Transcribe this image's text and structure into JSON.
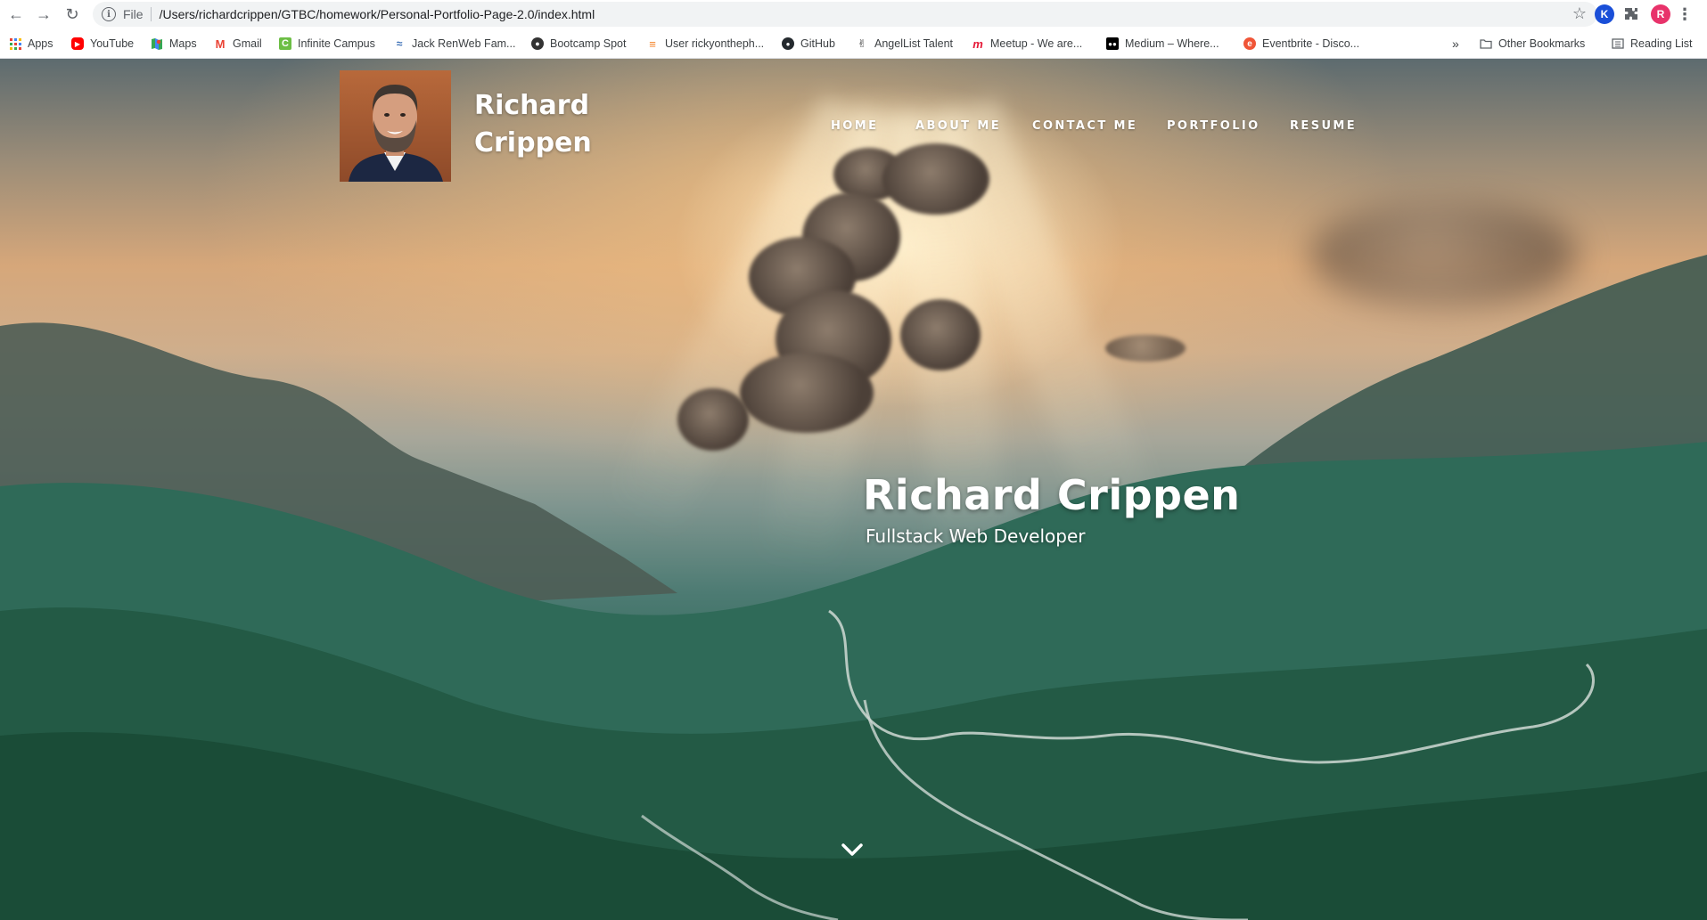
{
  "browser": {
    "url_scheme": "File",
    "url": "/Users/richardcrippen/GTBC/homework/Personal-Portfolio-Page-2.0/index.html",
    "profile_initial": "R",
    "extension_initial": "K"
  },
  "bookmarks": {
    "items": [
      {
        "label": "Apps",
        "icon": "apps-grid-icon"
      },
      {
        "label": "YouTube",
        "icon": "youtube-icon"
      },
      {
        "label": "Maps",
        "icon": "maps-icon"
      },
      {
        "label": "Gmail",
        "icon": "gmail-icon"
      },
      {
        "label": "Infinite Campus",
        "icon": "infinite-campus-icon"
      },
      {
        "label": "Jack RenWeb Fam...",
        "icon": "renweb-icon"
      },
      {
        "label": "Bootcamp Spot",
        "icon": "bootcamp-spot-icon"
      },
      {
        "label": "User rickyontheph...",
        "icon": "stackoverflow-icon"
      },
      {
        "label": "GitHub",
        "icon": "github-icon"
      },
      {
        "label": "AngelList Talent",
        "icon": "angellist-icon"
      },
      {
        "label": "Meetup - We are...",
        "icon": "meetup-icon"
      },
      {
        "label": "Medium – Where...",
        "icon": "medium-icon"
      },
      {
        "label": "Eventbrite - Disco...",
        "icon": "eventbrite-icon"
      }
    ],
    "overflow": "»",
    "other": "Other Bookmarks",
    "reading_list": "Reading List"
  },
  "site": {
    "brand_first": "Richard",
    "brand_last": "Crippen",
    "nav": [
      "HOME",
      "ABOUT ME",
      "CONTACT ME",
      "PORTFOLIO",
      "RESUME"
    ],
    "hero_title": "Richard Crippen",
    "hero_subtitle": "Fullstack Web Developer"
  },
  "colors": {
    "youtube": "#ff0000",
    "gmail": "#ea4335",
    "infinite_campus": "#6cbe45",
    "meetup": "#e51937",
    "eventbrite": "#f05537",
    "profile": "#e8336b",
    "extension": "#1a4fd8"
  }
}
